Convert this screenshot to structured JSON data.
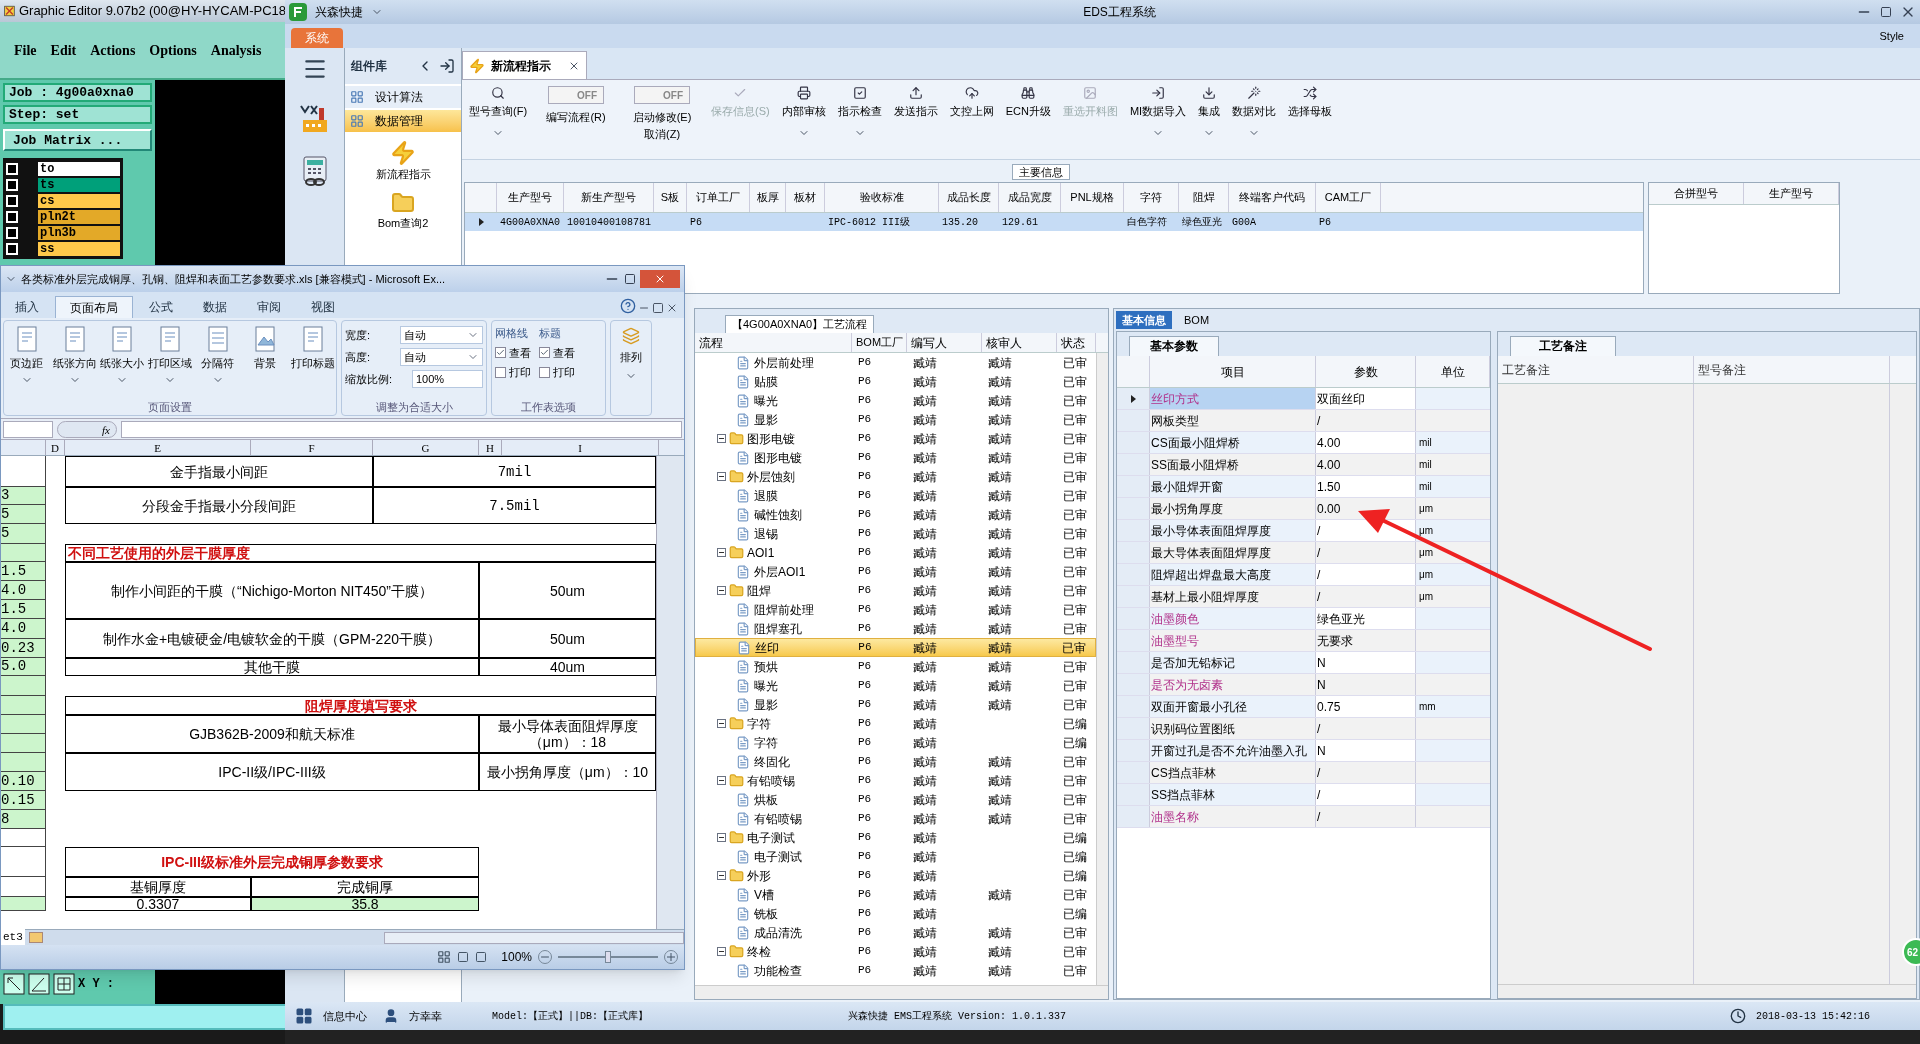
{
  "graphic_editor": {
    "title": "Graphic Editor 9.07b2 (00@HY-HYCAM-PC18",
    "menu": [
      "File",
      "Edit",
      "Actions",
      "Options",
      "Analysis"
    ],
    "job": "Job : 4g00a0xna0",
    "step": "Step: set",
    "matrix_button": "Job Matrix ...",
    "layers": [
      {
        "name": "to",
        "color": "#ffffff",
        "checked": false
      },
      {
        "name": "ts",
        "color": "#00a07a",
        "checked": false
      },
      {
        "name": "cs",
        "color": "#ffc94a",
        "checked": false
      },
      {
        "name": "pln2t",
        "color": "#e3a928",
        "checked": false
      },
      {
        "name": "pln3b",
        "color": "#e3a928",
        "checked": false
      },
      {
        "name": "ss",
        "color": "#ffc94a",
        "checked": false
      }
    ],
    "xy_label": "X Y :"
  },
  "ems": {
    "app_name": "兴森快捷",
    "title": "EDS工程系统",
    "ribbon_tabs": [
      {
        "label": "系统",
        "selected": true
      }
    ],
    "style_menu": "Style",
    "component_panel": {
      "title": "组件库",
      "items": [
        {
          "label": "设计算法",
          "selected": false
        },
        {
          "label": "数据管理",
          "selected": true
        }
      ],
      "shortcuts": [
        {
          "label": "新流程指示"
        },
        {
          "label": "Bom查询2"
        }
      ]
    },
    "doc_tabs": [
      {
        "label": "新流程指示",
        "selected": true
      }
    ],
    "toolbar": [
      {
        "kind": "button",
        "label": "型号查询(F)",
        "dropdown": true,
        "disabled": false
      },
      {
        "kind": "toggle",
        "label": "编写流程(R)",
        "state": "OFF",
        "on": false
      },
      {
        "kind": "toggle",
        "label": "启动修改(E)",
        "label2": "取消(Z)",
        "state": "OFF",
        "on": false
      },
      {
        "kind": "button",
        "label": "保存信息(S)",
        "dropdown": false,
        "disabled": true
      },
      {
        "kind": "button",
        "label": "内部审核",
        "dropdown": true,
        "disabled": false
      },
      {
        "kind": "button",
        "label": "指示检查",
        "dropdown": true,
        "disabled": false
      },
      {
        "kind": "button",
        "label": "发送指示",
        "dropdown": false,
        "disabled": false
      },
      {
        "kind": "button",
        "label": "文控上网",
        "dropdown": false,
        "disabled": false
      },
      {
        "kind": "button",
        "label": "ECN升级",
        "dropdown": false,
        "disabled": false
      },
      {
        "kind": "button",
        "label": "重选开料图",
        "dropdown": false,
        "disabled": true
      },
      {
        "kind": "button",
        "label": "MI数据导入",
        "dropdown": true,
        "disabled": false
      },
      {
        "kind": "button",
        "label": "集成",
        "dropdown": true,
        "disabled": false
      },
      {
        "kind": "button",
        "label": "数据对比",
        "dropdown": true,
        "disabled": false
      },
      {
        "kind": "button",
        "label": "选择母板",
        "dropdown": false,
        "disabled": false
      }
    ],
    "main_info": {
      "label": "主要信息",
      "columns": [
        "生产型号",
        "新生产型号",
        "S板",
        "订单工厂",
        "板厚",
        "板材",
        "验收标准",
        "成品长度",
        "成品宽度",
        "PNL规格",
        "字符",
        "阻焊",
        "终端客户代码",
        "CAM工厂"
      ],
      "rows": [
        {
          "selected": true,
          "cells": [
            "4G00A0XNA0",
            "10010400108781",
            null,
            "P6",
            null,
            null,
            "IPC-6012 III级",
            "135.20",
            "129.61",
            null,
            "白色字符",
            "绿色亚光",
            "G00A",
            "P6"
          ]
        }
      ],
      "side_columns": [
        "合拼型号",
        "生产型号"
      ]
    },
    "process": {
      "tab": "【4G00A0XNA0】工艺流程",
      "columns": [
        "流程",
        "BOM工厂",
        "编写人",
        "核审人",
        "状态"
      ],
      "scrolled_children": [
        {
          "name": "外层前处理",
          "factory": "P6",
          "writer": "臧靖",
          "reviewer": "臧靖",
          "status": "已审",
          "selected": false
        },
        {
          "name": "贴膜",
          "factory": "P6",
          "writer": "臧靖",
          "reviewer": "臧靖",
          "status": "已审",
          "selected": false
        },
        {
          "name": "曝光",
          "factory": "P6",
          "writer": "臧靖",
          "reviewer": "臧靖",
          "status": "已审",
          "selected": false
        },
        {
          "name": "显影",
          "factory": "P6",
          "writer": "臧靖",
          "reviewer": "臧靖",
          "status": "已审",
          "selected": false
        }
      ],
      "nodes": [
        {
          "name": "图形电镀",
          "factory": "P6",
          "writer": "臧靖",
          "reviewer": "臧靖",
          "status": "已审",
          "selected": false,
          "expanded": true,
          "children": [
            {
              "name": "图形电镀",
              "factory": "P6",
              "writer": "臧靖",
              "reviewer": "臧靖",
              "status": "已审",
              "selected": false
            }
          ]
        },
        {
          "name": "外层蚀刻",
          "factory": "P6",
          "writer": "臧靖",
          "reviewer": "臧靖",
          "status": "已审",
          "selected": false,
          "expanded": true,
          "children": [
            {
              "name": "退膜",
              "factory": "P6",
              "writer": "臧靖",
              "reviewer": "臧靖",
              "status": "已审",
              "selected": false
            },
            {
              "name": "碱性蚀刻",
              "factory": "P6",
              "writer": "臧靖",
              "reviewer": "臧靖",
              "status": "已审",
              "selected": false
            },
            {
              "name": "退锡",
              "factory": "P6",
              "writer": "臧靖",
              "reviewer": "臧靖",
              "status": "已审",
              "selected": false
            }
          ]
        },
        {
          "name": "AOI1",
          "factory": "P6",
          "writer": "臧靖",
          "reviewer": "臧靖",
          "status": "已审",
          "selected": false,
          "expanded": true,
          "children": [
            {
              "name": "外层AOI1",
              "factory": "P6",
              "writer": "臧靖",
              "reviewer": "臧靖",
              "status": "已审",
              "selected": false
            }
          ]
        },
        {
          "name": "阻焊",
          "factory": "P6",
          "writer": "臧靖",
          "reviewer": "臧靖",
          "status": "已审",
          "selected": false,
          "expanded": true,
          "children": [
            {
              "name": "阻焊前处理",
              "factory": "P6",
              "writer": "臧靖",
              "reviewer": "臧靖",
              "status": "已审",
              "selected": false
            },
            {
              "name": "阻焊塞孔",
              "factory": "P6",
              "writer": "臧靖",
              "reviewer": "臧靖",
              "status": "已审",
              "selected": false
            },
            {
              "name": "丝印",
              "factory": "P6",
              "writer": "臧靖",
              "reviewer": "臧靖",
              "status": "已审",
              "selected": true
            },
            {
              "name": "预烘",
              "factory": "P6",
              "writer": "臧靖",
              "reviewer": "臧靖",
              "status": "已审",
              "selected": false
            },
            {
              "name": "曝光",
              "factory": "P6",
              "writer": "臧靖",
              "reviewer": "臧靖",
              "status": "已审",
              "selected": false
            },
            {
              "name": "显影",
              "factory": "P6",
              "writer": "臧靖",
              "reviewer": "臧靖",
              "status": "已审",
              "selected": false
            }
          ]
        },
        {
          "name": "字符",
          "factory": "P6",
          "writer": "臧靖",
          "status": "已编",
          "selected": false,
          "expanded": true,
          "children": [
            {
              "name": "字符",
              "factory": "P6",
              "writer": "臧靖",
              "status": "已编",
              "selected": false
            },
            {
              "name": "终固化",
              "factory": "P6",
              "writer": "臧靖",
              "reviewer": "臧靖",
              "status": "已审",
              "selected": false
            }
          ]
        },
        {
          "name": "有铅喷锡",
          "factory": "P6",
          "writer": "臧靖",
          "reviewer": "臧靖",
          "status": "已审",
          "selected": false,
          "expanded": true,
          "children": [
            {
              "name": "烘板",
              "factory": "P6",
              "writer": "臧靖",
              "reviewer": "臧靖",
              "status": "已审",
              "selected": false
            },
            {
              "name": "有铅喷锡",
              "factory": "P6",
              "writer": "臧靖",
              "reviewer": "臧靖",
              "status": "已审",
              "selected": false
            }
          ]
        },
        {
          "name": "电子测试",
          "factory": "P6",
          "writer": "臧靖",
          "status": "已编",
          "selected": false,
          "expanded": true,
          "children": [
            {
              "name": "电子测试",
              "factory": "P6",
              "writer": "臧靖",
              "status": "已编",
              "selected": false
            }
          ]
        },
        {
          "name": "外形",
          "factory": "P6",
          "writer": "臧靖",
          "status": "已编",
          "selected": false,
          "expanded": true,
          "children": [
            {
              "name": "V槽",
              "factory": "P6",
              "writer": "臧靖",
              "reviewer": "臧靖",
              "status": "已审",
              "selected": false
            },
            {
              "name": "铣板",
              "factory": "P6",
              "writer": "臧靖",
              "status": "已编",
              "selected": false
            },
            {
              "name": "成品清洗",
              "factory": "P6",
              "writer": "臧靖",
              "reviewer": "臧靖",
              "status": "已审",
              "selected": false
            }
          ]
        },
        {
          "name": "终检",
          "factory": "P6",
          "writer": "臧靖",
          "reviewer": "臧靖",
          "status": "已审",
          "selected": false,
          "expanded": true,
          "children": [
            {
              "name": "功能检查",
              "factory": "P6",
              "writer": "臧靖",
              "reviewer": "臧靖",
              "status": "已审",
              "selected": false
            }
          ]
        }
      ]
    },
    "info_tabs": [
      {
        "label": "基本信息",
        "selected": true
      },
      {
        "label": "BOM",
        "selected": false
      }
    ],
    "params": {
      "section": "基本参数",
      "columns": [
        "项目",
        "参数",
        "单位"
      ],
      "rows": [
        {
          "item": "丝印方式",
          "value": "双面丝印",
          "highlighted": true,
          "selected": true
        },
        {
          "item": "网板类型",
          "value": "/",
          "highlighted": false,
          "selected": false
        },
        {
          "item": "CS面最小阻焊桥",
          "value": "4.00",
          "unit": "mil",
          "highlighted": false,
          "selected": false
        },
        {
          "item": "SS面最小阻焊桥",
          "value": "4.00",
          "unit": "mil",
          "highlighted": false,
          "selected": false
        },
        {
          "item": "最小阻焊开窗",
          "value": "1.50",
          "unit": "mil",
          "highlighted": false,
          "selected": false
        },
        {
          "item": "最小拐角厚度",
          "value": "0.00",
          "unit": "μm",
          "highlighted": false,
          "selected": false
        },
        {
          "item": "最小导体表面阻焊厚度",
          "value": "/",
          "unit": "μm",
          "highlighted": false,
          "selected": false
        },
        {
          "item": "最大导体表面阻焊厚度",
          "value": "/",
          "unit": "μm",
          "highlighted": false,
          "selected": false
        },
        {
          "item": "阻焊超出焊盘最大高度",
          "value": "/",
          "unit": "μm",
          "highlighted": false,
          "selected": false
        },
        {
          "item": "基材上最小阻焊厚度",
          "value": "/",
          "unit": "μm",
          "highlighted": false,
          "selected": false
        },
        {
          "item": "油墨颜色",
          "value": "绿色亚光",
          "highlighted": true,
          "selected": false
        },
        {
          "item": "油墨型号",
          "value": "无要求",
          "highlighted": true,
          "selected": false
        },
        {
          "item": "是否加无铅标记",
          "value": "N",
          "highlighted": false,
          "selected": false
        },
        {
          "item": "是否为无卤素",
          "value": "N",
          "highlighted": true,
          "selected": false
        },
        {
          "item": "双面开窗最小孔径",
          "value": "0.75",
          "unit": "mm",
          "highlighted": false,
          "selected": false
        },
        {
          "item": "识别码位置图纸",
          "value": "/",
          "highlighted": false,
          "selected": false
        },
        {
          "item": "开窗过孔是否不允许油墨入孔",
          "value": "N",
          "highlighted": false,
          "selected": false
        },
        {
          "item": "CS挡点菲林",
          "value": "/",
          "highlighted": false,
          "selected": false
        },
        {
          "item": "SS挡点菲林",
          "value": "/",
          "highlighted": false,
          "selected": false
        },
        {
          "item": "油墨名称",
          "value": "/",
          "highlighted": true,
          "selected": false
        }
      ]
    },
    "remarks": {
      "section": "工艺备注",
      "columns": [
        "工艺备注",
        "型号备注"
      ]
    },
    "status_bar": {
      "info": "信息中心",
      "user": "方幸幸",
      "model": "Model:【正式】||DB:【正式库】",
      "version": "兴森快捷 EMS工程系统 Version: 1.0.1.337",
      "datetime": "2018-03-13 15:42:16"
    },
    "badge": "62"
  },
  "excel": {
    "title": "各类标准外层完成铜厚、孔铜、阻焊和表面工艺参数要求.xls [兼容模式] - Microsoft Ex...",
    "tabs": [
      {
        "label": "插入",
        "selected": false
      },
      {
        "label": "页面布局",
        "selected": true
      },
      {
        "label": "公式",
        "selected": false
      },
      {
        "label": "数据",
        "selected": false
      },
      {
        "label": "审阅",
        "selected": false
      },
      {
        "label": "视图",
        "selected": false
      }
    ],
    "page_setup": {
      "label": "页面设置",
      "buttons": [
        {
          "label": "页边距",
          "dropdown": true
        },
        {
          "label": "纸张方向",
          "dropdown": true
        },
        {
          "label": "纸张大小",
          "dropdown": true
        },
        {
          "label": "打印区域",
          "dropdown": true
        },
        {
          "label": "分隔符",
          "dropdown": true
        },
        {
          "label": "背景",
          "dropdown": false
        },
        {
          "label": "打印标题",
          "dropdown": false
        }
      ]
    },
    "scale": {
      "label": "调整为合适大小",
      "width_label": "宽度:",
      "width": "自动",
      "height_label": "高度:",
      "height": "自动",
      "zoom_label": "缩放比例:",
      "zoom": "100%"
    },
    "sheet_options": {
      "label": "工作表选项",
      "groups": [
        {
          "title": "网格线",
          "view": {
            "label": "查看",
            "checked": true
          },
          "print": {
            "label": "打印",
            "checked": false
          }
        },
        {
          "title": "标题",
          "view": {
            "label": "查看",
            "checked": true
          },
          "print": {
            "label": "打印",
            "checked": false
          }
        }
      ]
    },
    "arrange": "排列",
    "formula_icon": "fx",
    "column_headers": [
      "D",
      "E",
      "F",
      "G",
      "H",
      "I"
    ],
    "left_column": [
      "3",
      "5",
      "5",
      "1.5",
      "4.0",
      "1.5",
      "4.0",
      "0.23",
      "5.0",
      "0.10",
      "0.15",
      "8"
    ],
    "tables": [
      {
        "rows": [
          [
            "金手指最小间距",
            "7mil"
          ],
          [
            "分段金手指最小分段间距",
            "7.5mil"
          ]
        ]
      },
      {
        "title": "不同工艺使用的外层干膜厚度",
        "rows": [
          [
            "制作小间距的干膜（“Nichigo-Morton NIT450”干膜）",
            "50um"
          ],
          [
            "制作水金+电镀硬金/电镀软金的干膜（GPM-220干膜）",
            "50um"
          ],
          [
            "其他干膜",
            "40um"
          ]
        ]
      },
      {
        "title": "阻焊厚度填写要求",
        "rows": [
          [
            "GJB362B-2009和航天标准",
            "最小导体表面阻焊厚度（μm）：18"
          ],
          [
            "IPC-II级/IPC-III级",
            "最小拐角厚度（μm）：10"
          ]
        ]
      },
      {
        "title": "IPC-III级标准外层完成铜厚参数要求",
        "rows": [
          [
            "基铜厚度",
            "完成铜厚"
          ],
          [
            "0.3307",
            "35.8"
          ]
        ]
      }
    ],
    "sheet_tab": "et3",
    "zoom": "100%",
    "zoom_slider": {
      "level": 0.5
    }
  }
}
